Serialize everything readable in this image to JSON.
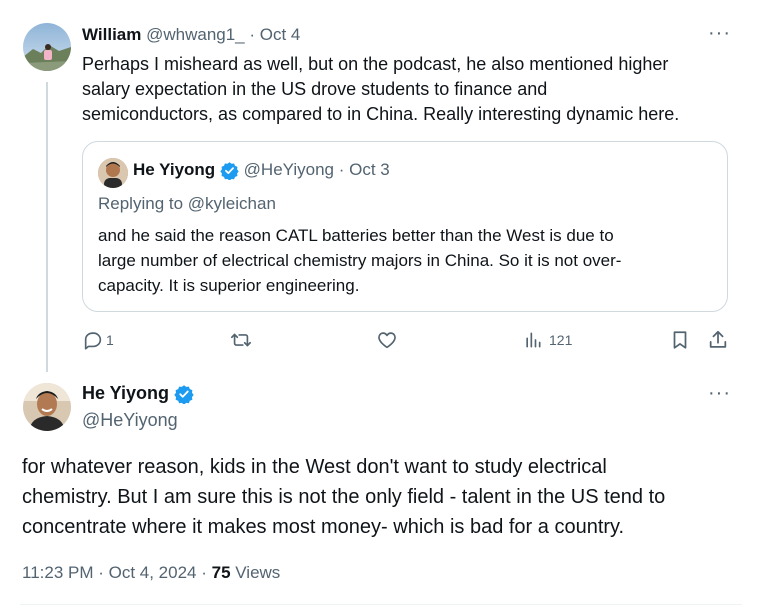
{
  "reply_tweet": {
    "author_name": "William",
    "author_handle": "@whwang1_",
    "date": "· Oct 4",
    "text_lines": [
      "Perhaps I misheard as well, but on the podcast, he also mentioned higher",
      "salary expectation in the US drove students to finance and",
      "semiconductors, as compared to in China. Really interesting dynamic here."
    ],
    "more_icon": "more-dots-icon"
  },
  "quoted_tweet": {
    "author_name": "He Yiyong",
    "author_handle": "@HeYiyong",
    "date": "· Oct 3",
    "replying_to": "Replying to @kyleichan",
    "text_lines": [
      "and he said the reason CATL batteries better than the West is due to",
      "large number of electrical chemistry majors in China. So it is not over-",
      "capacity. It is superior engineering."
    ]
  },
  "actions": {
    "reply_count": "1",
    "views_count": "121",
    "icons": [
      "reply-icon",
      "retweet-icon",
      "like-icon",
      "views-icon",
      "bookmark-icon",
      "share-icon"
    ]
  },
  "main_tweet": {
    "author_name": "He Yiyong",
    "author_handle": "@HeYiyong",
    "text_lines": [
      "for whatever reason, kids in the West don't want to study electrical",
      "chemistry. But I am sure this is not the only field - talent in the US tend to",
      "concentrate where it makes most money- which is bad for a country."
    ],
    "timestamp": "11:23 PM · Oct 4, 2024 · ",
    "views_count": "75",
    "views_label": "Views"
  },
  "colors": {
    "accent": "#1d9bf0",
    "muted": "#536471",
    "border": "#cfd9de"
  }
}
